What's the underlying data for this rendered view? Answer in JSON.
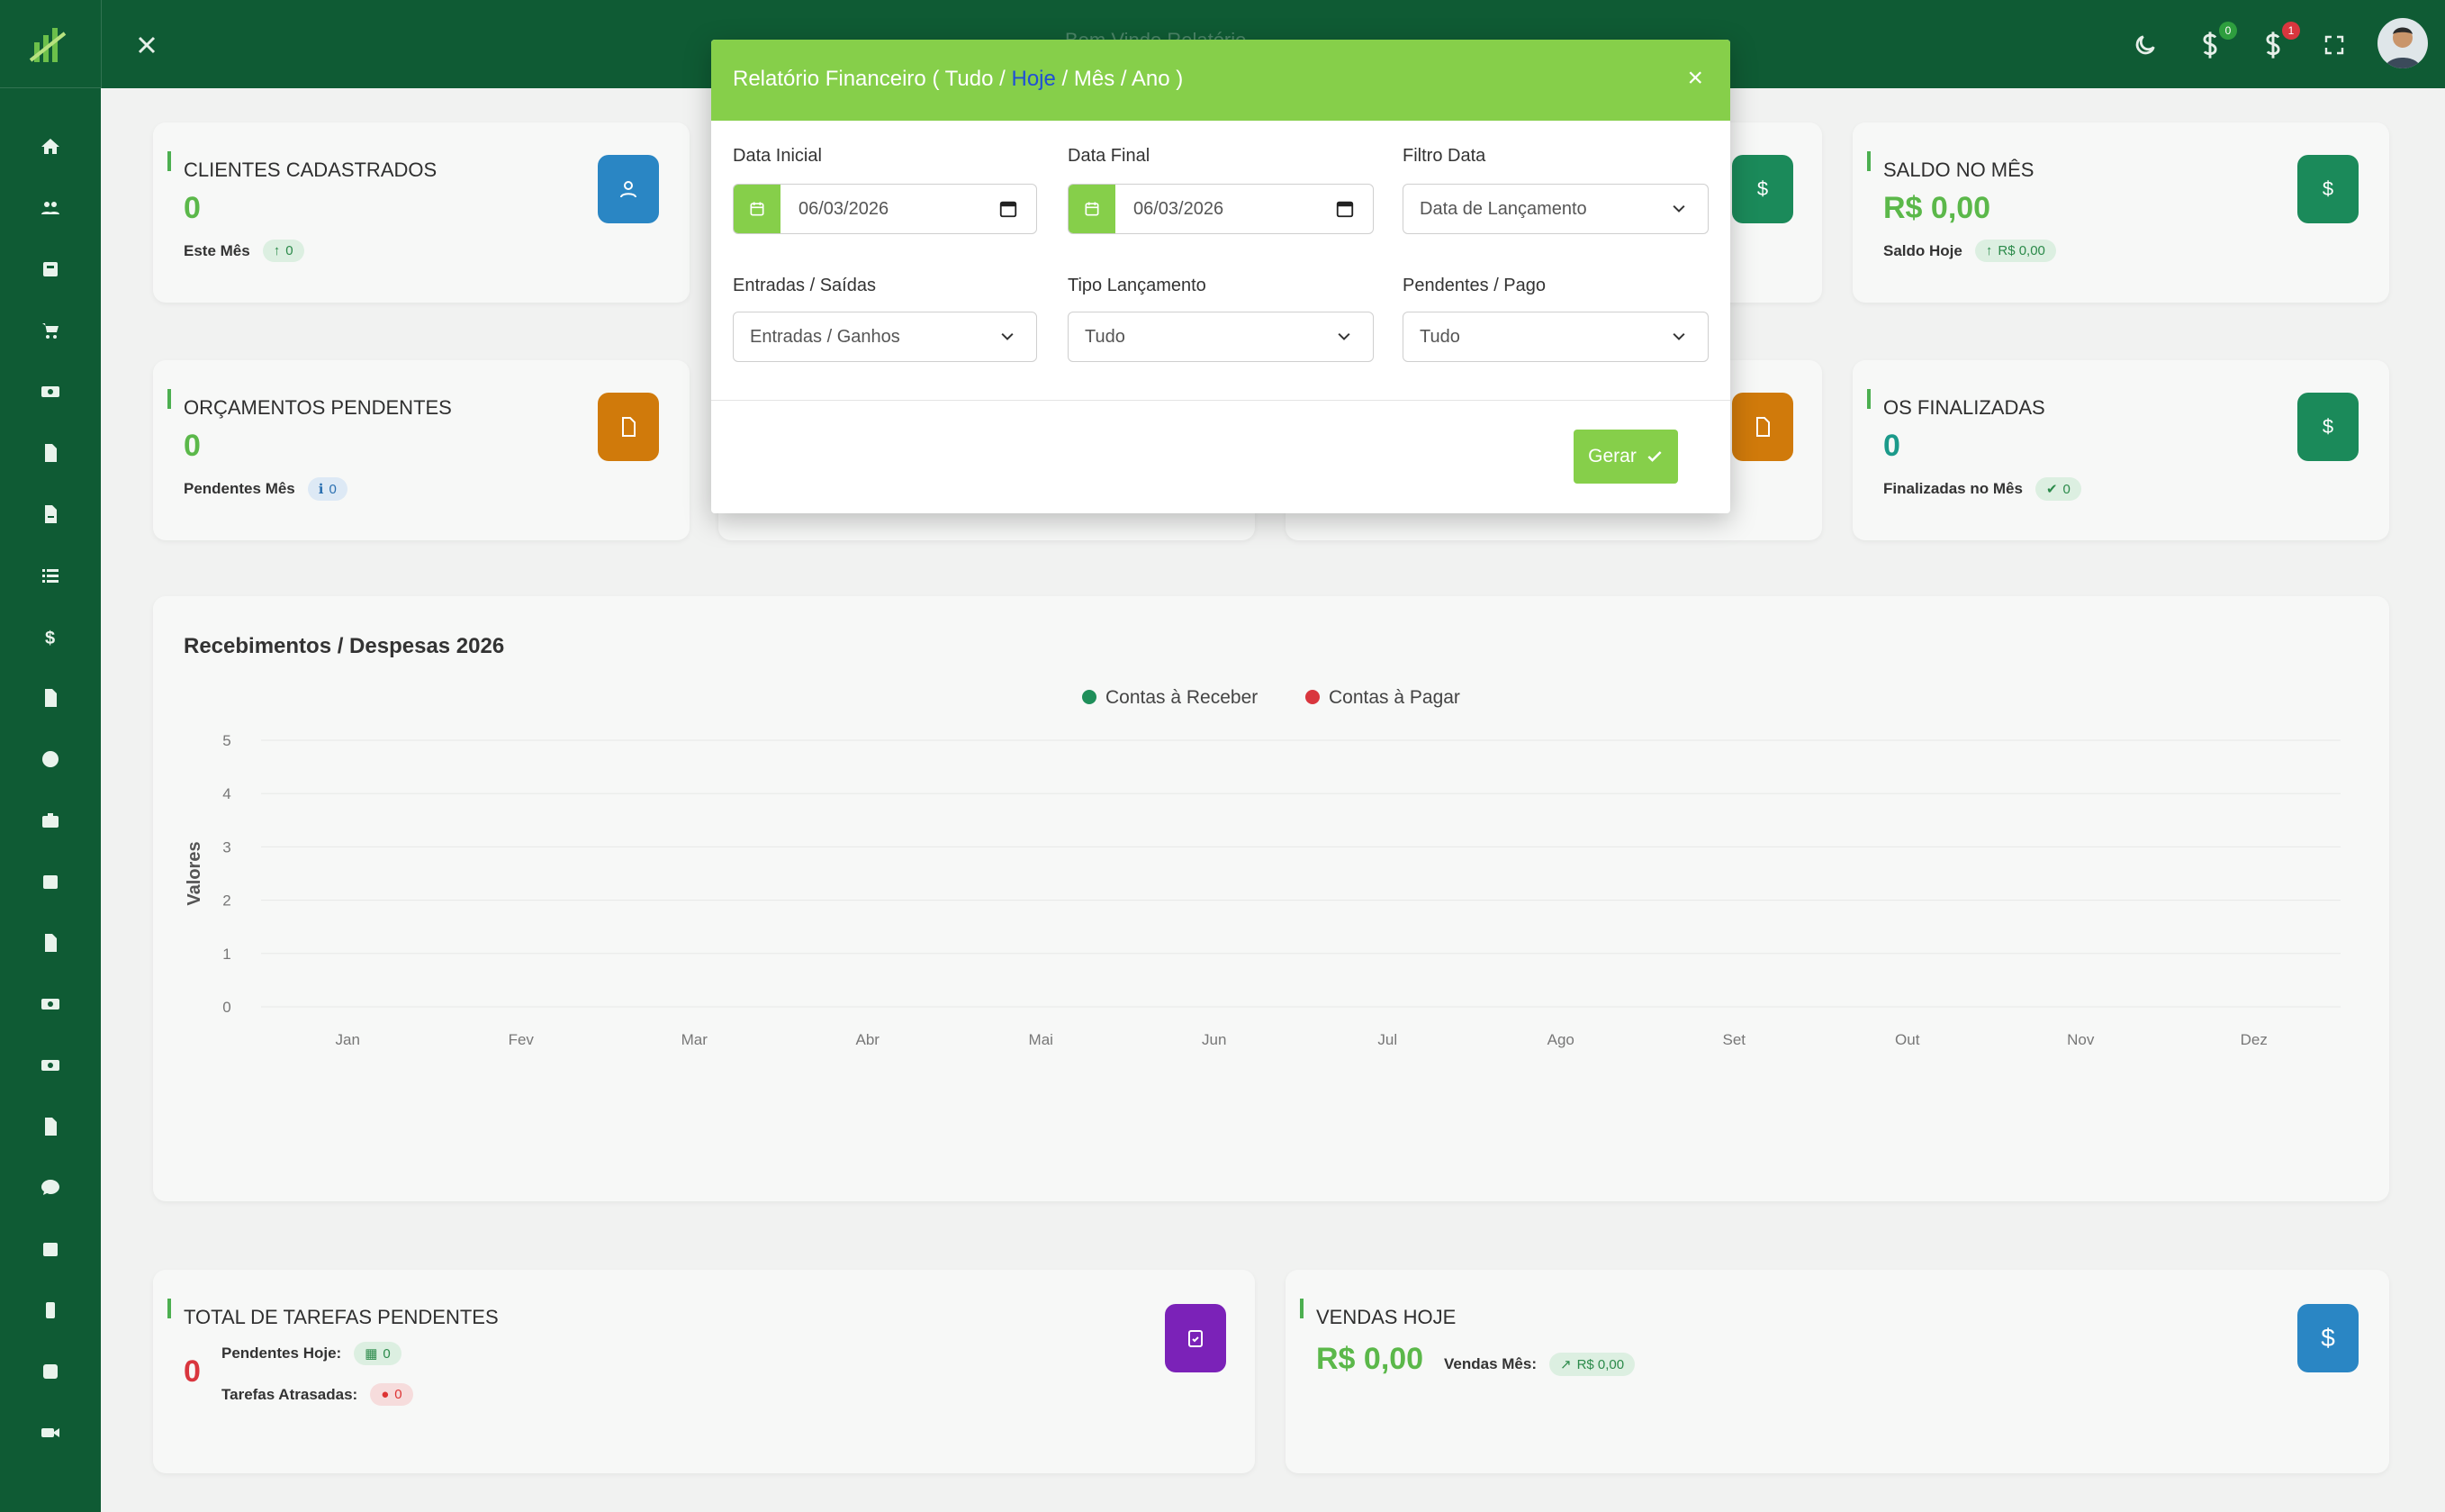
{
  "topbar": {
    "title": "Bem Vindo Relatório",
    "badge_green": "0",
    "badge_red": "1"
  },
  "cards": {
    "clientes": {
      "title": "CLIENTES CADASTRADOS",
      "value": "0",
      "sub_label": "Este Mês",
      "sub_value": "0"
    },
    "saldo": {
      "title": "SALDO NO MÊS",
      "value": "R$ 0,00",
      "sub_label": "Saldo Hoje",
      "sub_value": "R$ 0,00"
    },
    "orcamentos": {
      "title": "ORÇAMENTOS PENDENTES",
      "value": "0",
      "sub_label": "Pendentes Mês",
      "sub_value": "0"
    },
    "os": {
      "title": "OS FINALIZADAS",
      "value": "0",
      "sub_label": "Finalizadas no Mês",
      "sub_value": "0"
    },
    "tarefas": {
      "title": "TOTAL DE TAREFAS PENDENTES",
      "value": "0",
      "pend_label": "Pendentes Hoje:",
      "pend_value": "0",
      "atras_label": "Tarefas Atrasadas:",
      "atras_value": "0"
    },
    "vendas": {
      "title": "VENDAS HOJE",
      "value": "R$ 0,00",
      "sub_label": "Vendas Mês:",
      "sub_value": "R$ 0,00"
    }
  },
  "chart_data": {
    "type": "line",
    "title": "Recebimentos / Despesas 2026",
    "ylabel": "Valores",
    "xlabel": "",
    "categories": [
      "Jan",
      "Fev",
      "Mar",
      "Abr",
      "Mai",
      "Jun",
      "Jul",
      "Ago",
      "Set",
      "Out",
      "Nov",
      "Dez"
    ],
    "ylim": [
      0,
      5
    ],
    "yticks": [
      "0",
      "1",
      "2",
      "3",
      "4",
      "5"
    ],
    "legend_position": "top-center",
    "series": [
      {
        "name": "Contas à Receber",
        "color": "#1f8f5a",
        "values": [
          0,
          0,
          0,
          0,
          0,
          0,
          0,
          0,
          0,
          0,
          0,
          0
        ]
      },
      {
        "name": "Contas à Pagar",
        "color": "#d9363e",
        "values": [
          0,
          0,
          0,
          0,
          0,
          0,
          0,
          0,
          0,
          0,
          0,
          0
        ]
      }
    ]
  },
  "modal": {
    "title_prefix": "Relatório Financeiro ( Tudo / ",
    "title_highlight": "Hoje",
    "title_suffix": " / Mês / Ano )",
    "close": "×",
    "data_inicial_label": "Data Inicial",
    "data_inicial_value": "06/03/2026",
    "data_final_label": "Data Final",
    "data_final_value": "06/03/2026",
    "filtro_label": "Filtro Data",
    "filtro_value": "Data de Lançamento",
    "entradas_label": "Entradas / Saídas",
    "entradas_value": "Entradas / Ganhos",
    "tipo_label": "Tipo Lançamento",
    "tipo_value": "Tudo",
    "pendentes_label": "Pendentes / Pago",
    "pendentes_value": "Tudo",
    "gerar_label": "Gerar"
  },
  "colors": {
    "sidebar": "#0f5b34",
    "modal_accent": "#86cf4a",
    "highlight": "#1f4fd6"
  }
}
